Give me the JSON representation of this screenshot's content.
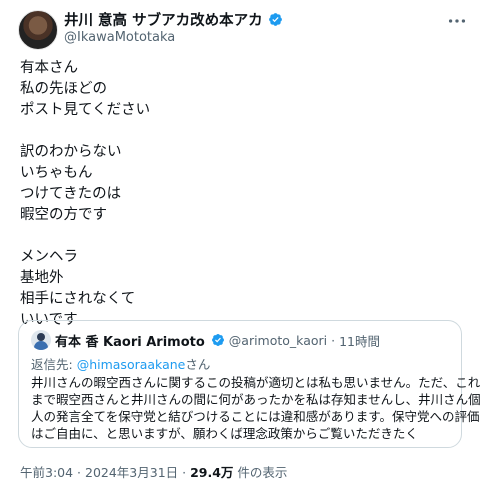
{
  "author": {
    "name": "井川 意高 サブアカ改め本アカ",
    "handle": "@IkawaMototaka"
  },
  "post": {
    "lines": [
      "有本さん",
      "私の先ほどの",
      "ポスト見てください",
      "",
      "訳のわからない",
      "いちゃもん",
      "つけてきたのは",
      "暇空の方です",
      "",
      "メンヘラ",
      "基地外",
      "相手にされなくて",
      "いいです"
    ]
  },
  "quote": {
    "name": "有本 香 Kaori Arimoto",
    "handle": "@arimoto_kaori",
    "separator": "·",
    "time": "11時間",
    "reply_prefix": "返信先:",
    "reply_link": "@himasoraakane",
    "reply_suffix": "さん",
    "body_lines": [
      "井川さんの暇空西さんに関するこの投稿が適切とは私も思いません。ただ、これ",
      "まで暇空西さんと井川さんの間に何があったかを私は存知ませんし、井川さん個",
      "人の発言全てを保守党と結びつけることには違和感があります。保守党への評価",
      "はご自由に、と思いますが、願わくば理念政策からご覧いただきたく"
    ]
  },
  "meta": {
    "datetime": "午前3:04 · 2024年3月31日 · ",
    "views": "29.4万",
    "views_suffix": " 件の表示"
  },
  "colors": {
    "verified": "#1d9bf0",
    "secondary_text": "#536471",
    "border": "#cfd9de"
  },
  "icons": {
    "verified": "verified-badge-icon",
    "more": "more-options-icon"
  }
}
